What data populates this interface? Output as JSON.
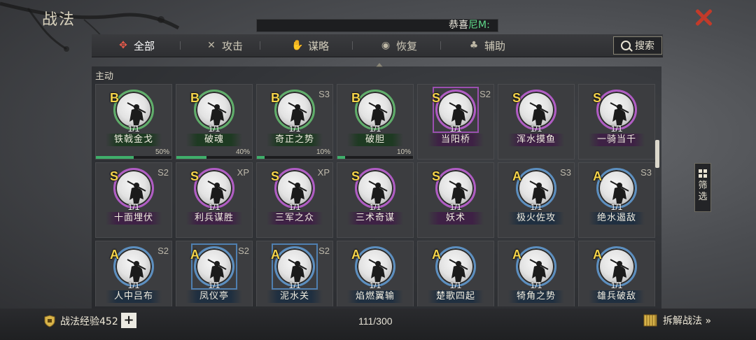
{
  "header": {
    "title": "战法",
    "marquee_prefix": "恭喜",
    "marquee_highlight": "尼M:"
  },
  "tabs": [
    {
      "label": "全部",
      "icon": "scroll-icon",
      "active": true
    },
    {
      "label": "攻击",
      "icon": "crossed-swords-icon",
      "active": false
    },
    {
      "label": "谋略",
      "icon": "hand-icon",
      "active": false
    },
    {
      "label": "恢复",
      "icon": "cauldron-icon",
      "active": false
    },
    {
      "label": "辅助",
      "icon": "bag-icon",
      "active": false
    }
  ],
  "search": {
    "label": "搜索"
  },
  "section": {
    "label": "主动"
  },
  "cards": [
    {
      "grade": "B",
      "tag": "",
      "level": "1/1",
      "name": "铁戟金戈",
      "progress": "50%",
      "fill": 0.5
    },
    {
      "grade": "B",
      "tag": "",
      "level": "1/1",
      "name": "破魂",
      "progress": "40%",
      "fill": 0.4
    },
    {
      "grade": "B",
      "tag": "S3",
      "level": "1/1",
      "name": "奇正之势",
      "progress": "10%",
      "fill": 0.1
    },
    {
      "grade": "B",
      "tag": "",
      "level": "1/1",
      "name": "破胆",
      "progress": "10%",
      "fill": 0.1
    },
    {
      "grade": "S",
      "tag": "S2",
      "level": "1/1",
      "name": "当阳桥",
      "progress": "",
      "fill": 0,
      "framed": true
    },
    {
      "grade": "S",
      "tag": "",
      "level": "1/1",
      "name": "浑水摸鱼",
      "progress": "",
      "fill": 0
    },
    {
      "grade": "S",
      "tag": "",
      "level": "1/1",
      "name": "一骑当千",
      "progress": "",
      "fill": 0
    },
    {
      "grade": "S",
      "tag": "S2",
      "level": "1/1",
      "name": "十面埋伏",
      "progress": "",
      "fill": 0
    },
    {
      "grade": "S",
      "tag": "XP",
      "level": "1/1",
      "name": "利兵谋胜",
      "progress": "",
      "fill": 0
    },
    {
      "grade": "S",
      "tag": "XP",
      "level": "1/1",
      "name": "三军之众",
      "progress": "",
      "fill": 0
    },
    {
      "grade": "S",
      "tag": "",
      "level": "1/1",
      "name": "三术奇谋",
      "progress": "",
      "fill": 0
    },
    {
      "grade": "S",
      "tag": "",
      "level": "1/1",
      "name": "妖术",
      "progress": "",
      "fill": 0
    },
    {
      "grade": "A",
      "tag": "S3",
      "level": "1/1",
      "name": "极火佐攻",
      "progress": "",
      "fill": 0
    },
    {
      "grade": "A",
      "tag": "S3",
      "level": "1/1",
      "name": "绝水遏敌",
      "progress": "",
      "fill": 0
    },
    {
      "grade": "A",
      "tag": "S2",
      "level": "1/1",
      "name": "人中吕布",
      "progress": "",
      "fill": 0
    },
    {
      "grade": "A",
      "tag": "S2",
      "level": "1/1",
      "name": "凤仪亭",
      "progress": "",
      "fill": 0,
      "framed": true
    },
    {
      "grade": "A",
      "tag": "S2",
      "level": "1/1",
      "name": "泥水关",
      "progress": "",
      "fill": 0,
      "framed": true
    },
    {
      "grade": "A",
      "tag": "",
      "level": "1/1",
      "name": "焰燃翼输",
      "progress": "",
      "fill": 0
    },
    {
      "grade": "A",
      "tag": "",
      "level": "1/1",
      "name": "楚歌四起",
      "progress": "",
      "fill": 0
    },
    {
      "grade": "A",
      "tag": "",
      "level": "1/1",
      "name": "犄角之势",
      "progress": "",
      "fill": 0
    },
    {
      "grade": "A",
      "tag": "",
      "level": "1/1",
      "name": "雄兵破敌",
      "progress": "",
      "fill": 0
    }
  ],
  "filter": {
    "label1": "筛",
    "label2": "选"
  },
  "footer": {
    "exp_label": "战法经验452",
    "plus": "+",
    "count": "111/300",
    "decompose_label": "拆解战法 »"
  }
}
